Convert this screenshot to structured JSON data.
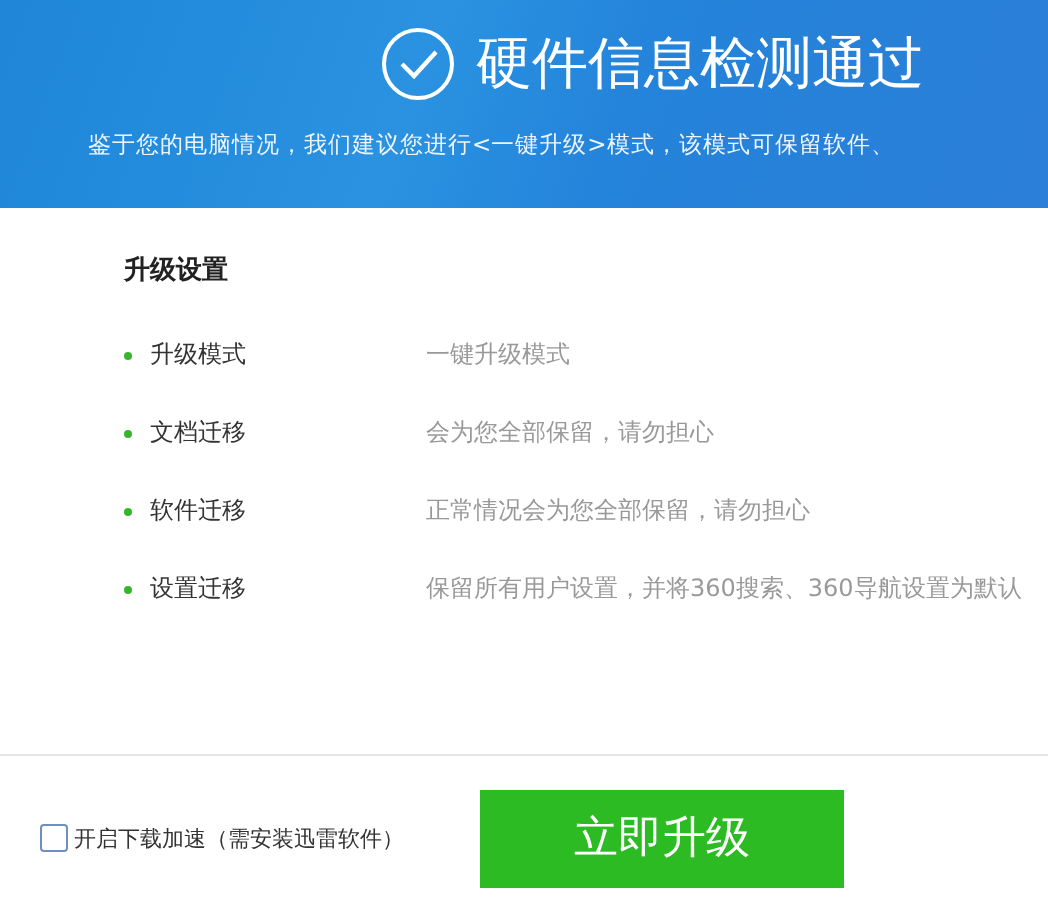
{
  "header": {
    "title": "硬件信息检测通过",
    "subtitle": "鉴于您的电脑情况，我们建议您进行<一键升级>模式，该模式可保留软件、"
  },
  "settings": {
    "heading": "升级设置",
    "rows": [
      {
        "label": "升级模式",
        "value": "一键升级模式"
      },
      {
        "label": "文档迁移",
        "value": "会为您全部保留，请勿担心"
      },
      {
        "label": "软件迁移",
        "value": "正常情况会为您全部保留，请勿担心"
      },
      {
        "label": "设置迁移",
        "value": "保留所有用户设置，并将360搜索、360导航设置为默认"
      }
    ]
  },
  "footer": {
    "accelerate": {
      "label": "开启下载加速（需安装迅雷软件）",
      "checked": false
    },
    "button": "立即升级"
  }
}
